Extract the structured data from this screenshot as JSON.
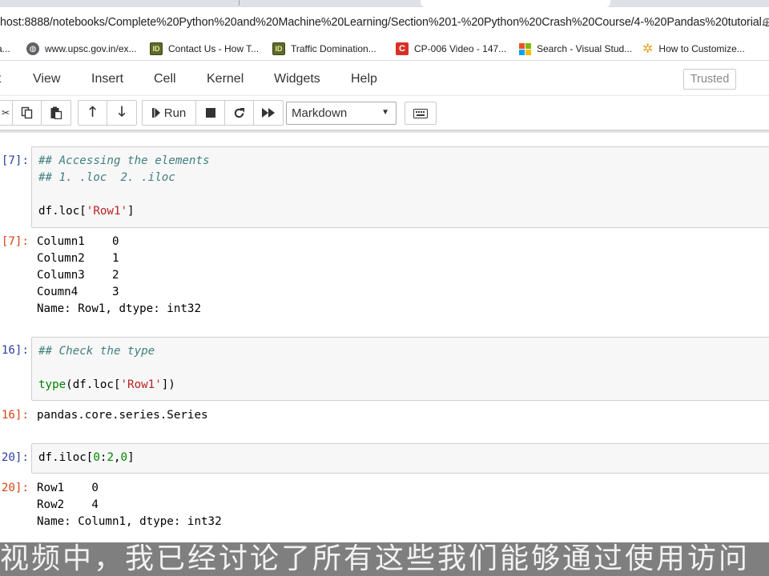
{
  "browser": {
    "url": "host:8888/notebooks/Complete%20Python%20and%20Machine%20Learning/Section%201-%20Python%20Crash%20Course/4-%20Pandas%20tutorial...",
    "bookmarks": [
      {
        "label": "a...",
        "icon": "bookmark-icon"
      },
      {
        "label": "www.upsc.gov.in/ex...",
        "icon": "globe-icon"
      },
      {
        "label": "Contact Us - How T...",
        "icon": "id-icon"
      },
      {
        "label": "Traffic Domination...",
        "icon": "id-icon"
      },
      {
        "label": "CP-006 Video - 147...",
        "icon": "c-icon"
      },
      {
        "label": "Search - Visual Stud...",
        "icon": "microsoft-icon"
      },
      {
        "label": "How to Customize...",
        "icon": "gear-icon"
      }
    ]
  },
  "menubar": {
    "items": [
      "t",
      "View",
      "Insert",
      "Cell",
      "Kernel",
      "Widgets",
      "Help"
    ],
    "trusted": "Trusted"
  },
  "toolbar": {
    "run_label": "Run",
    "cell_type": "Markdown"
  },
  "cells": [
    {
      "in_prompt": "[7]:",
      "lines": [
        "## Accessing the elements",
        "## 1. .loc  2. .iloc",
        "",
        "df.loc['Row1']"
      ],
      "out_prompt": "[7]:",
      "output": [
        "Column1    0",
        "Column2    1",
        "Column3    2",
        "Coumn4     3",
        "Name: Row1, dtype: int32"
      ]
    },
    {
      "in_prompt": "16]:",
      "lines": [
        "## Check the type",
        "",
        "type(df.loc['Row1'])"
      ],
      "out_prompt": "16]:",
      "output": [
        "pandas.core.series.Series"
      ]
    },
    {
      "in_prompt": "20]:",
      "lines": [
        "df.iloc[0:2,0]"
      ],
      "out_prompt": "20]:",
      "output": [
        "Row1    0",
        "Row2    4",
        "Name: Column1, dtype: int32"
      ]
    }
  ],
  "subtitle": "视频中，我已经讨论了所有这些我们能够通过使用访问"
}
